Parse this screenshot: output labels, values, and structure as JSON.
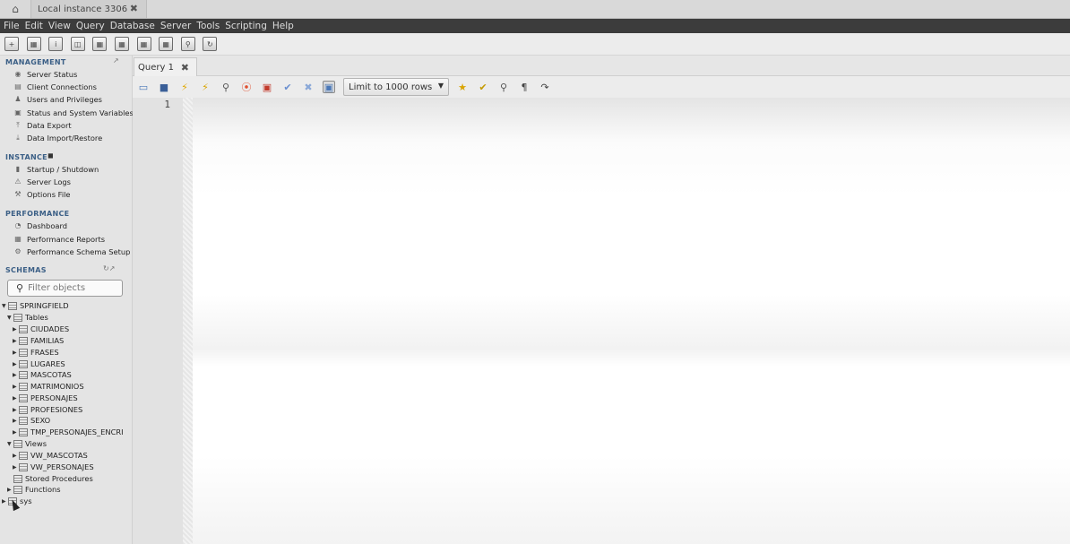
{
  "window": {
    "home_icon": "home-icon",
    "tab_title": "Local instance 3306",
    "tab_close": "✖"
  },
  "menu": [
    "File",
    "Edit",
    "View",
    "Query",
    "Database",
    "Server",
    "Tools",
    "Scripting",
    "Help"
  ],
  "sidebar": {
    "management": {
      "title": "MANAGEMENT",
      "items": [
        "Server Status",
        "Client Connections",
        "Users and Privileges",
        "Status and System Variables",
        "Data Export",
        "Data Import/Restore"
      ]
    },
    "instance": {
      "title": "INSTANCE",
      "items": [
        "Startup / Shutdown",
        "Server Logs",
        "Options File"
      ]
    },
    "performance": {
      "title": "PERFORMANCE",
      "items": [
        "Dashboard",
        "Performance Reports",
        "Performance Schema Setup"
      ]
    },
    "schemas": {
      "title": "SCHEMAS",
      "filter_placeholder": "Filter objects",
      "db": "SPRINGFIELD",
      "tables_label": "Tables",
      "tables": [
        "CIUDADES",
        "FAMILIAS",
        "FRASES",
        "LUGARES",
        "MASCOTAS",
        "MATRIMONIOS",
        "PERSONAJES",
        "PROFESIONES",
        "SEXO",
        "TMP_PERSONAJES_ENCRI"
      ],
      "views_label": "Views",
      "views": [
        "VW_MASCOTAS",
        "VW_PERSONAJES"
      ],
      "procedures_label": "Stored Procedures",
      "functions_label": "Functions",
      "other_db": "sys"
    }
  },
  "query": {
    "tab_label": "Query 1",
    "tab_close": "✖",
    "limit_label": "Limit to 1000 rows",
    "line_number": "1"
  }
}
